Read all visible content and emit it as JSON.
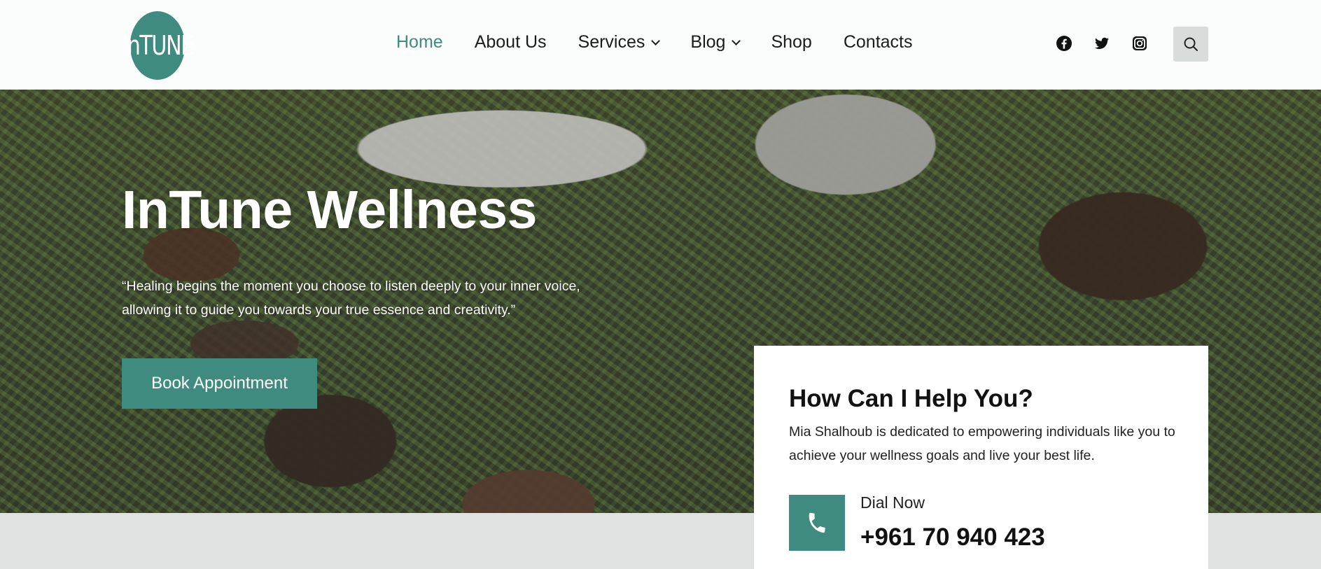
{
  "header": {
    "logo_text": "InTUNE",
    "nav": [
      {
        "label": "Home",
        "active": true,
        "dropdown": false
      },
      {
        "label": "About Us",
        "active": false,
        "dropdown": false
      },
      {
        "label": "Services",
        "active": false,
        "dropdown": true
      },
      {
        "label": "Blog",
        "active": false,
        "dropdown": true
      },
      {
        "label": "Shop",
        "active": false,
        "dropdown": false
      },
      {
        "label": "Contacts",
        "active": false,
        "dropdown": false
      }
    ],
    "social_icons": [
      "facebook-icon",
      "twitter-icon",
      "instagram-icon"
    ],
    "search_icon": "search-icon"
  },
  "hero": {
    "title": "InTune Wellness",
    "quote": "“Healing begins the moment you choose to listen deeply to your inner voice, allowing it to guide you towards your true essence and creativity.”",
    "cta_label": "Book Appointment"
  },
  "help_card": {
    "title": "How Can I Help You?",
    "text": "Mia Shalhoub is dedicated to empowering individuals like you to achieve your wellness goals and live your best life.",
    "dial_label": "Dial Now",
    "phone": "+961 70 940 423",
    "phone_icon": "phone-icon"
  },
  "colors": {
    "accent": "#3f8b80",
    "header_bg": "#fbfcfc",
    "footer_strip": "#dfe2e1"
  }
}
